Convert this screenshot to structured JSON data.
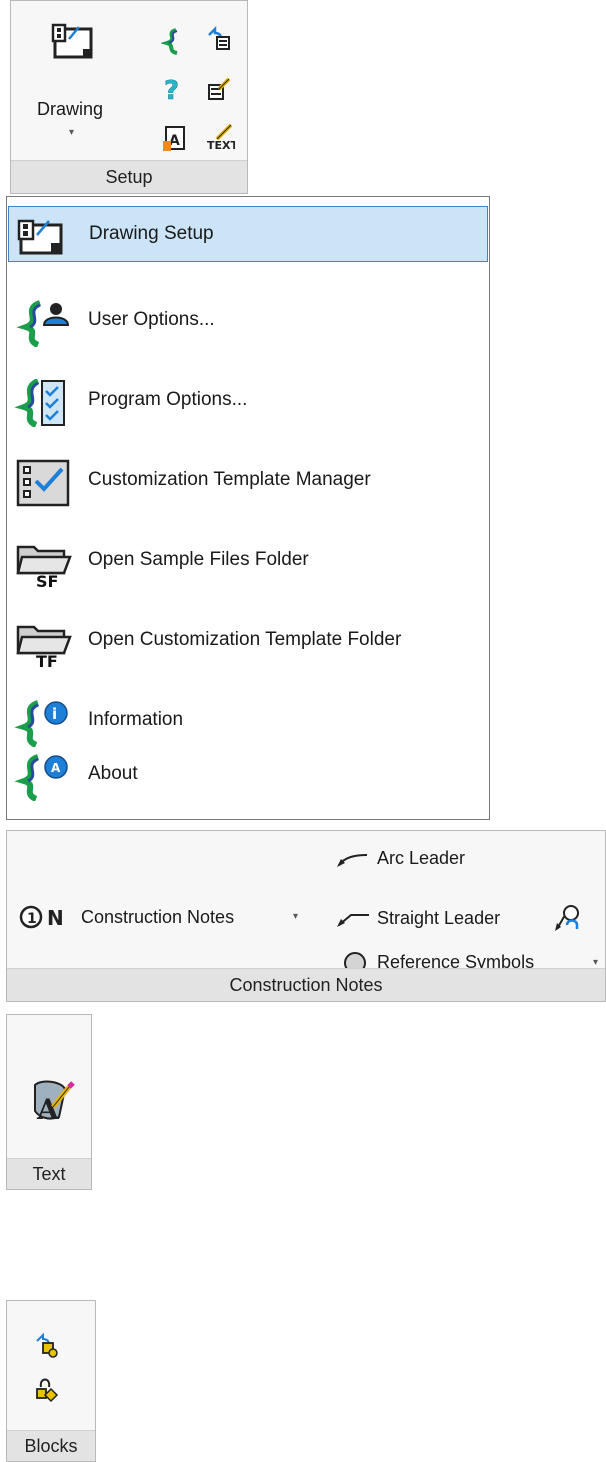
{
  "setup_panel": {
    "drawing_label": "Drawing",
    "title": "Setup",
    "small_icons": [
      "s-logo-icon",
      "undo-list-icon",
      "help-question-icon",
      "edit-list-icon",
      "text-style-icon",
      "text-edit-icon"
    ]
  },
  "setup_menu": {
    "items": [
      {
        "label": "Drawing Setup",
        "icon": "drawing-setup-icon",
        "selected": true
      },
      {
        "label": "User Options...",
        "icon": "user-options-icon"
      },
      {
        "label": "Program Options...",
        "icon": "program-options-icon"
      },
      {
        "label": "Customization Template Manager",
        "icon": "template-manager-icon"
      },
      {
        "label": "Open Sample Files Folder",
        "icon": "sample-folder-icon"
      },
      {
        "label": "Open Customization Template Folder",
        "icon": "template-folder-icon"
      },
      {
        "label": "Information",
        "icon": "information-icon"
      },
      {
        "label": "About",
        "icon": "about-icon"
      }
    ]
  },
  "construction_panel": {
    "construction_notes_label": "Construction Notes",
    "arc_leader_label": "Arc Leader",
    "straight_leader_label": "Straight Leader",
    "reference_symbols_label": "Reference Symbols",
    "title": "Construction Notes"
  },
  "text_panel": {
    "title": "Text"
  },
  "blocks_panel": {
    "title": "Blocks"
  },
  "colors": {
    "accent_blue": "#1e7fd6",
    "menu_selected_bg": "#cce4f7",
    "menu_selected_border": "#3d83c9",
    "brand_green": "#1a9e4a"
  }
}
